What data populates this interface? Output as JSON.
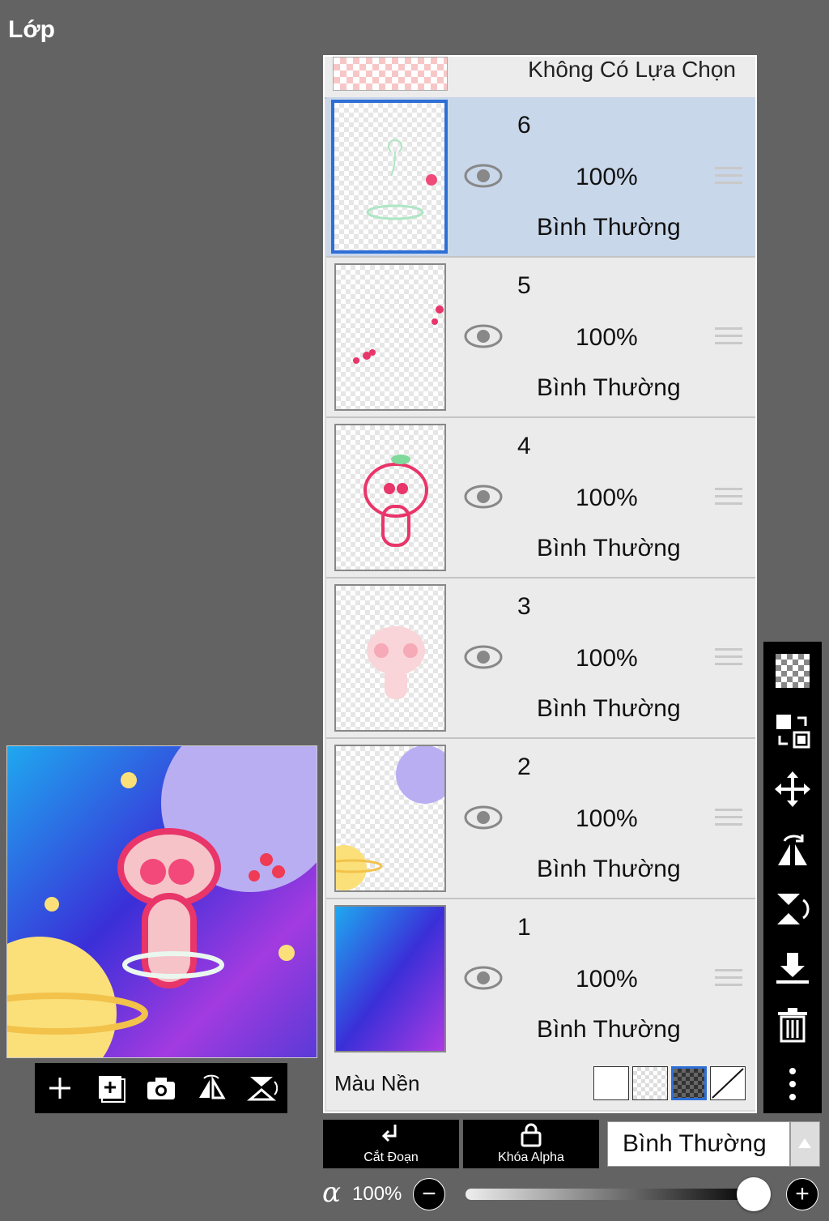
{
  "panel_title": "Lớp",
  "selection_row": {
    "label": "Không Có Lựa Chọn"
  },
  "layers": [
    {
      "number": "6",
      "opacity": "100%",
      "blend_mode": "Bình Thường",
      "selected": true
    },
    {
      "number": "5",
      "opacity": "100%",
      "blend_mode": "Bình Thường",
      "selected": false
    },
    {
      "number": "4",
      "opacity": "100%",
      "blend_mode": "Bình Thường",
      "selected": false
    },
    {
      "number": "3",
      "opacity": "100%",
      "blend_mode": "Bình Thường",
      "selected": false
    },
    {
      "number": "2",
      "opacity": "100%",
      "blend_mode": "Bình Thường",
      "selected": false
    },
    {
      "number": "1",
      "opacity": "100%",
      "blend_mode": "Bình Thường",
      "selected": false
    }
  ],
  "background_color": {
    "label": "Màu Nền",
    "options": [
      "white-swatch",
      "transparent-swatch",
      "dark-checker-swatch",
      "none-swatch"
    ],
    "selected": "dark-checker-swatch"
  },
  "actions": {
    "clipping_label": "Cắt Đoạn",
    "alpha_lock_label": "Khóa Alpha",
    "blend_mode_value": "Bình Thường"
  },
  "alpha": {
    "symbol": "α",
    "value": "100%",
    "fraction": 1.0
  },
  "bottom_tools": [
    "add-layer-icon",
    "add-image-layer-icon",
    "camera-icon",
    "flip-horizontal-icon",
    "flip-vertical-icon"
  ],
  "right_tools": [
    "transparency-icon",
    "swap-layers-icon",
    "move-icon",
    "flip-horizontal-icon",
    "flip-vertical-icon",
    "merge-down-icon",
    "trash-icon",
    "more-icon"
  ],
  "colors": {
    "selected_row": "#c9d7ea",
    "selection_border": "#2e6fd6",
    "panel_bg": "#636363"
  }
}
